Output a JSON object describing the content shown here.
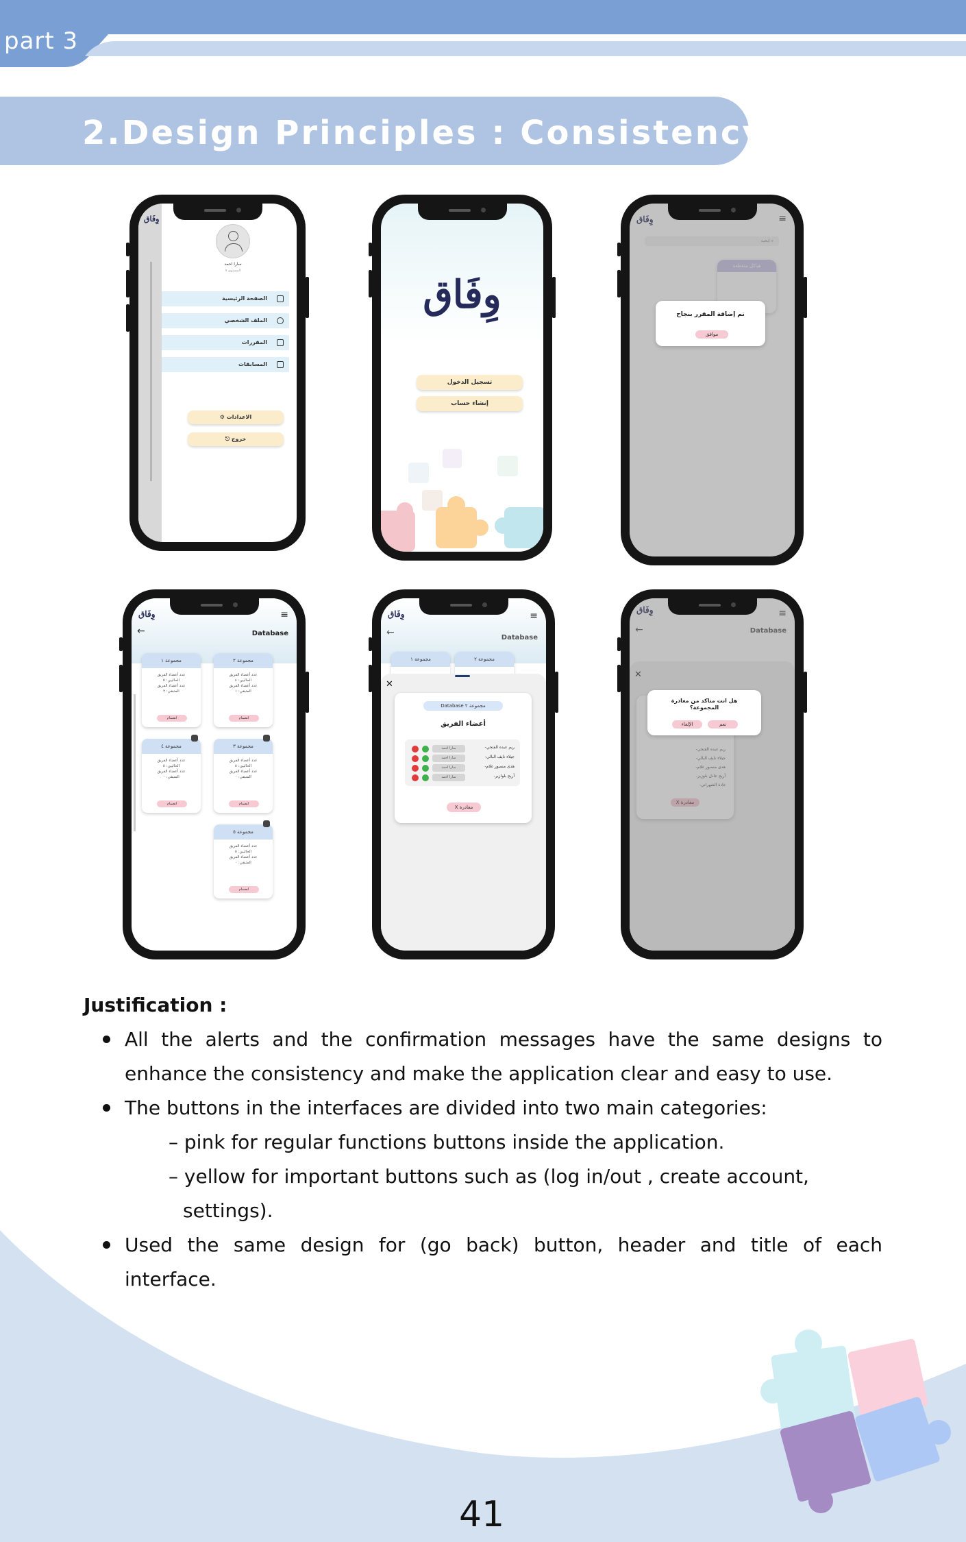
{
  "header": {
    "part_label": "part 3",
    "title": "2.Design Principles  : Consistency"
  },
  "colors": {
    "header_band": "#7a9fd4",
    "title_banner": "#afc4e3",
    "button_yellow": "#fbeccb",
    "button_pink": "#f7c9d2",
    "card_header_blue": "#cfe0f5",
    "page_wave": "#d3e1f1"
  },
  "phone_sidebar": {
    "user_name": "سارا احمد",
    "user_level": "المستوى ٧",
    "items": [
      "الصفحة الرئيسية",
      "الملف الشخصي",
      "المقررات",
      "المسابقات"
    ],
    "settings_button": "الاعدادات",
    "logout_button": "خروج",
    "logo": "وِفَاق"
  },
  "phone_welcome": {
    "logo": "وِفَاق",
    "login_button": "تسجيل الدخول",
    "create_account_button": "إنشاء حساب"
  },
  "phone_alert": {
    "logo": "وِفَاق",
    "search_placeholder": "ابحث",
    "course_card_title": "هياكل متقطعة",
    "alert_message": "تم إضافة المقرر بنجاح",
    "ok_button": "موافق"
  },
  "phone_groups": {
    "logo": "وِفَاق",
    "course_title": "Database",
    "groups": [
      {
        "name": "مجموعة ١",
        "line1": "عدد أعضاء الفريق",
        "line2": "الحاليين: ٥",
        "line3": "عدد أعضاء الفريق",
        "line4": "المتبقي: ٢",
        "button": "انضمام",
        "locked": false
      },
      {
        "name": "مجموعة ٢",
        "line1": "عدد أعضاء الفريق",
        "line2": "الحاليين: ٤",
        "line3": "عدد أعضاء الفريق",
        "line4": "المتبقي: ١",
        "button": "انضمام",
        "locked": false
      },
      {
        "name": "مجموعة ٤",
        "line1": "عدد أعضاء الفريق",
        "line2": "الحاليين: ٥",
        "line3": "عدد أعضاء الفريق",
        "line4": "المتبقي: ٠",
        "button": "انضمام",
        "locked": true
      },
      {
        "name": "مجموعة ٣",
        "line1": "عدد أعضاء الفريق",
        "line2": "الحاليين: ٥",
        "line3": "عدد أعضاء الفريق",
        "line4": "المتبقي: ٠",
        "button": "انضمام",
        "locked": true
      },
      {
        "name": "مجموعة ٥",
        "line1": "عدد أعضاء الفريق",
        "line2": "الحاليين: ٥",
        "line3": "عدد أعضاء الفريق",
        "line4": "المتبقي: ٠",
        "button": "انضمام",
        "locked": true
      }
    ]
  },
  "phone_members": {
    "logo": "وِفَاق",
    "course_title": "Database",
    "tab1": "مجموعة ١",
    "tab2": "مجموعة ٢",
    "sheet_title": "Database مجموعة ٢",
    "members_heading": "أعضاء الفريق",
    "members": [
      "-ريم عبده الفتحي",
      "-جيلاء نايف البالي",
      "-هدى منصور غلام",
      "-أريج بلوازير"
    ],
    "request_name": "سارا احمد",
    "leave_button": "X مغادرة"
  },
  "phone_confirm": {
    "logo": "وِفَاق",
    "course_title": "Database",
    "confirm_message": "هل انت متاكد من مغادرة المجموعة؟",
    "cancel_button": "الإلغاء",
    "yes_button": "نعم",
    "members": [
      "-ريم عبده الفتحي",
      "-جيلاء نايف البالي",
      "-هدى منصور غلام",
      "-أريج عادل بلوزير",
      "-غادة الشهراني"
    ],
    "leave_button": "X مغادرة"
  },
  "justification": {
    "title": "Justification :",
    "bullet1_line1": "All the alerts and the confirmation messages have the same designs to",
    "bullet1_line2": "enhance the consistency and make the application clear and easy to use.",
    "bullet2": "The buttons in the interfaces are divided into two main categories:",
    "sub1": "– pink for regular functions buttons inside the application.",
    "sub2_line1": "– yellow for important buttons such as (log in/out , create account,",
    "sub2_line2": "settings).",
    "bullet3_line1": "Used the same design for (go back)  button, header and title of each",
    "bullet3_line2": "interface."
  },
  "page_number": "41"
}
